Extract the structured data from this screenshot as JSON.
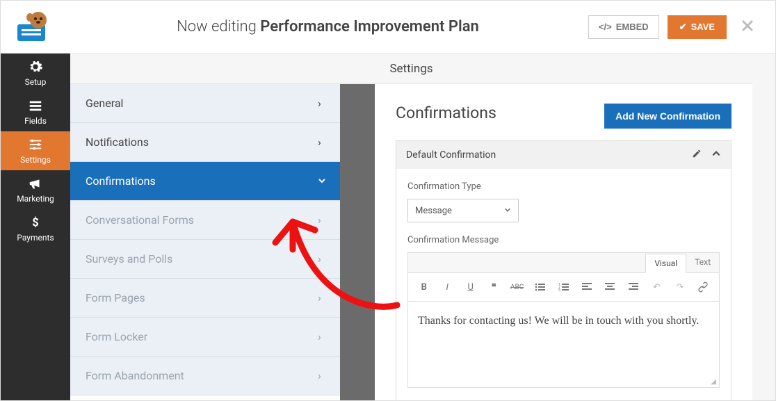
{
  "header": {
    "editing_prefix": "Now editing",
    "form_name": "Performance Improvement Plan",
    "embed_label": "EMBED",
    "save_label": "SAVE"
  },
  "sidebar": {
    "items": [
      {
        "label": "Setup",
        "icon": "gear"
      },
      {
        "label": "Fields",
        "icon": "list"
      },
      {
        "label": "Settings",
        "icon": "sliders",
        "active": true
      },
      {
        "label": "Marketing",
        "icon": "bullhorn"
      },
      {
        "label": "Payments",
        "icon": "dollar"
      }
    ]
  },
  "panel_title": "Settings",
  "settings_menu": [
    {
      "label": "General"
    },
    {
      "label": "Notifications"
    },
    {
      "label": "Confirmations",
      "selected": true
    },
    {
      "label": "Conversational Forms",
      "muted": true
    },
    {
      "label": "Surveys and Polls",
      "muted": true
    },
    {
      "label": "Form Pages",
      "muted": true
    },
    {
      "label": "Form Locker",
      "muted": true
    },
    {
      "label": "Form Abandonment",
      "muted": true
    }
  ],
  "content": {
    "heading": "Confirmations",
    "add_button": "Add New Confirmation",
    "card_title": "Default Confirmation",
    "type_label": "Confirmation Type",
    "type_value": "Message",
    "message_label": "Confirmation Message",
    "editor_tabs": {
      "visual": "Visual",
      "text": "Text"
    },
    "editor_value": "Thanks for contacting us! We will be in touch with you shortly."
  }
}
